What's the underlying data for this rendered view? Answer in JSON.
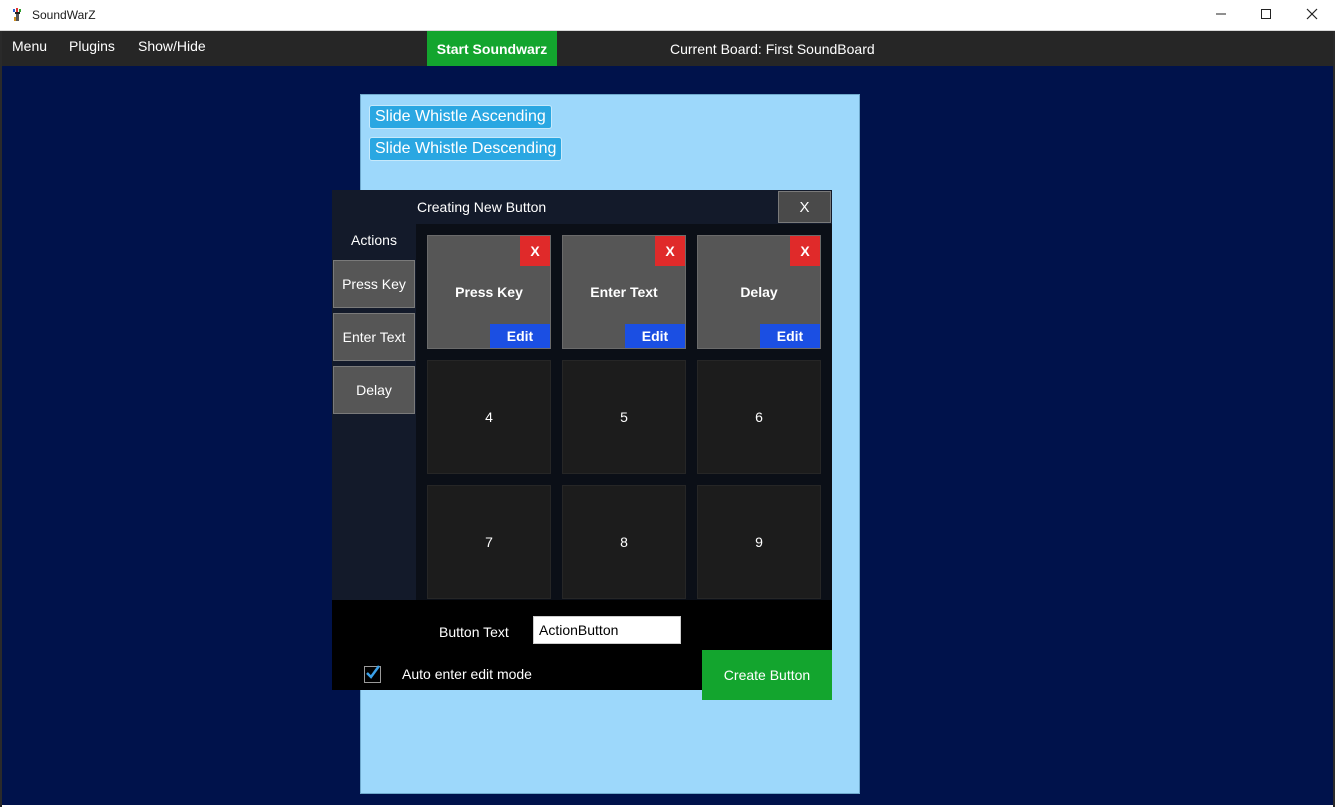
{
  "window": {
    "title": "SoundWarZ",
    "icon": "soundwarz-app-icon",
    "controls": {
      "minimize": "minimize-icon",
      "maximize": "maximize-icon",
      "close": "close-icon"
    }
  },
  "menubar": {
    "items": [
      {
        "label": "Menu"
      },
      {
        "label": "Plugins"
      },
      {
        "label": "Show/Hide"
      }
    ],
    "start_button": "Start Soundwarz",
    "current_board": "Current Board: First SoundBoard"
  },
  "board": {
    "buttons": [
      {
        "label": "Slide Whistle Ascending"
      },
      {
        "label": "Slide Whistle Descending"
      }
    ]
  },
  "dialog": {
    "title": "Creating New Button",
    "close_label": "X",
    "sidebar": {
      "heading": "Actions",
      "items": [
        {
          "label": "Press Key"
        },
        {
          "label": "Enter Text"
        },
        {
          "label": "Delay"
        }
      ]
    },
    "grid": {
      "actions": [
        {
          "label": "Press Key",
          "remove_label": "X",
          "edit_label": "Edit"
        },
        {
          "label": "Enter Text",
          "remove_label": "X",
          "edit_label": "Edit"
        },
        {
          "label": "Delay",
          "remove_label": "X",
          "edit_label": "Edit"
        }
      ],
      "empty_slots": [
        "4",
        "5",
        "6",
        "7",
        "8",
        "9"
      ]
    },
    "button_text_label": "Button Text",
    "button_text_value": "ActionButton",
    "auto_edit_label": "Auto enter edit mode",
    "auto_edit_checked": true,
    "create_button": "Create Button"
  },
  "colors": {
    "background": "#00124b",
    "board": "#9dd8fb",
    "accent_green": "#13a52e",
    "edit_blue": "#1b4fe3",
    "remove_red": "#e02a2a"
  }
}
